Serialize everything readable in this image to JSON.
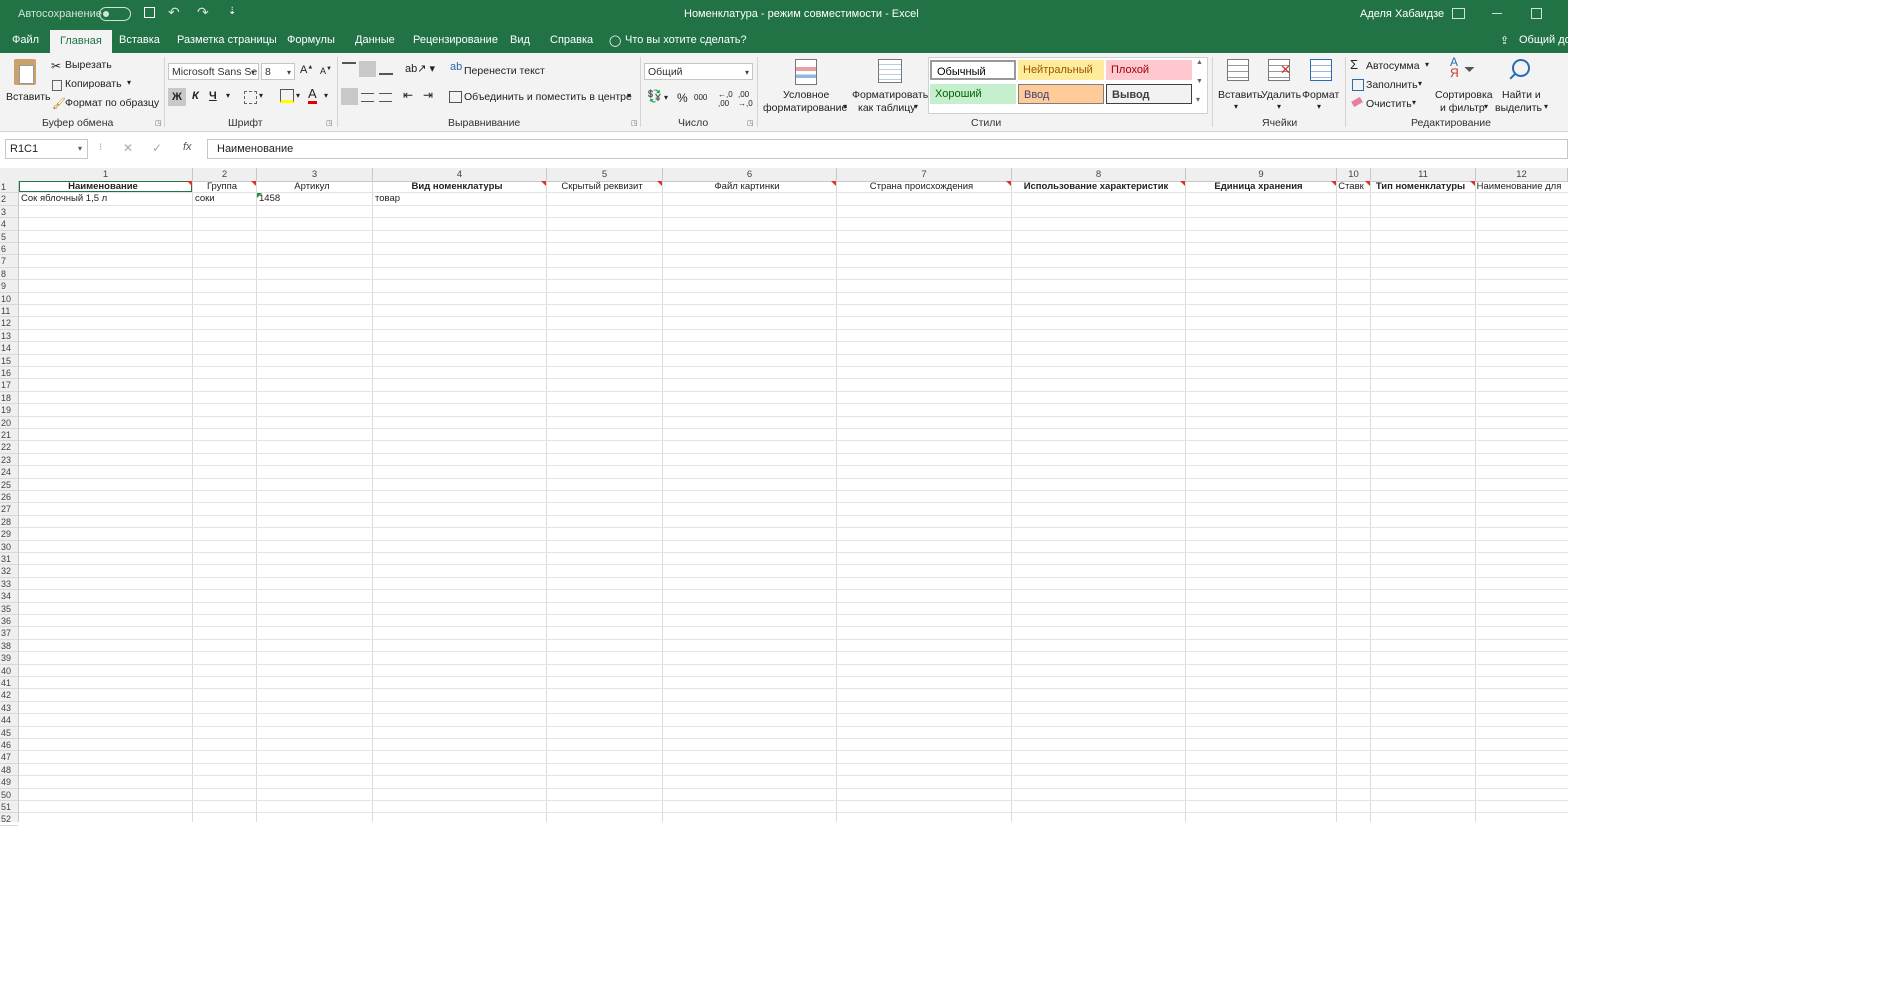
{
  "titlebar": {
    "autosave_label": "Автосохранение",
    "autosave_state": "Откл.",
    "document_title": "Номенклатура  -  режим совместимости  -  Excel",
    "user_name": "Аделя Хабаидзе"
  },
  "tabs": [
    "Файл",
    "Главная",
    "Вставка",
    "Разметка страницы",
    "Формулы",
    "Данные",
    "Рецензирование",
    "Вид",
    "Справка"
  ],
  "tell_me": "Что вы хотите сделать?",
  "share": "Общий до",
  "ribbon": {
    "clipboard": {
      "paste": "Вставить",
      "cut": "Вырезать",
      "copy": "Копировать",
      "format_painter": "Формат по образцу",
      "label": "Буфер обмена"
    },
    "font": {
      "name": "Microsoft Sans Se",
      "size": "8",
      "bold": "Ж",
      "italic": "К",
      "underline": "Ч",
      "label": "Шрифт"
    },
    "alignment": {
      "wrap": "Перенести текст",
      "merge": "Объединить и поместить в центре",
      "label": "Выравнивание"
    },
    "number": {
      "format": "Общий",
      "percent": "%",
      "thousands": "000",
      "label": "Число"
    },
    "styles": {
      "conditional": [
        "Условное",
        "форматирование"
      ],
      "as_table": [
        "Форматировать",
        "как таблицу"
      ],
      "items": [
        {
          "name": "Обычный",
          "bg": "#ffffff",
          "fg": "#000000"
        },
        {
          "name": "Нейтральный",
          "bg": "#ffeb9c",
          "fg": "#9c5700"
        },
        {
          "name": "Плохой",
          "bg": "#ffc7ce",
          "fg": "#9c0006"
        },
        {
          "name": "Хороший",
          "bg": "#c6efce",
          "fg": "#006100"
        },
        {
          "name": "Ввод",
          "bg": "#ffcc99",
          "fg": "#3f3f76"
        },
        {
          "name": "Вывод",
          "bg": "#f2f2f2",
          "fg": "#3f3f3f"
        }
      ],
      "label": "Стили"
    },
    "cells": {
      "insert": "Вставить",
      "delete": "Удалить",
      "format": "Формат",
      "label": "Ячейки"
    },
    "editing": {
      "autosum": "Автосумма",
      "fill": "Заполнить",
      "clear": "Очистить",
      "sort": [
        "Сортировка",
        "и фильтр"
      ],
      "find": [
        "Найти и",
        "выделить"
      ],
      "label": "Редактирование"
    }
  },
  "formula_bar": {
    "name_box": "R1C1",
    "fx": "fx",
    "content": "Наименование"
  },
  "grid": {
    "columns": [
      "1",
      "2",
      "3",
      "4",
      "5",
      "6",
      "7",
      "8",
      "9",
      "10",
      "11",
      "12"
    ],
    "rows": [
      "1",
      "2",
      "3",
      "4",
      "5",
      "6",
      "7",
      "8",
      "9",
      "10",
      "11",
      "12",
      "13",
      "14",
      "15",
      "16",
      "17",
      "18",
      "19",
      "20",
      "21",
      "22",
      "23",
      "24",
      "25",
      "26",
      "27",
      "28",
      "29",
      "30",
      "31",
      "32",
      "33",
      "34",
      "35",
      "36",
      "37",
      "38",
      "39",
      "40",
      "41",
      "42",
      "43",
      "44",
      "45",
      "46",
      "47",
      "48",
      "49",
      "50",
      "51",
      "52"
    ],
    "row1": [
      "Наименование",
      "Группа",
      "Артикул",
      "Вид номенклатуры",
      "Скрытый реквизит",
      "Файл картинки",
      "Страна происхождения",
      "Использование характеристик",
      "Единица хранения",
      "Ставк",
      "Тип номенклатуры",
      "Наименование для"
    ],
    "row2": [
      "Сок яблочный 1,5 л",
      "соки",
      "1458",
      "товар",
      "",
      "",
      "",
      "",
      "",
      "",
      "",
      ""
    ]
  }
}
